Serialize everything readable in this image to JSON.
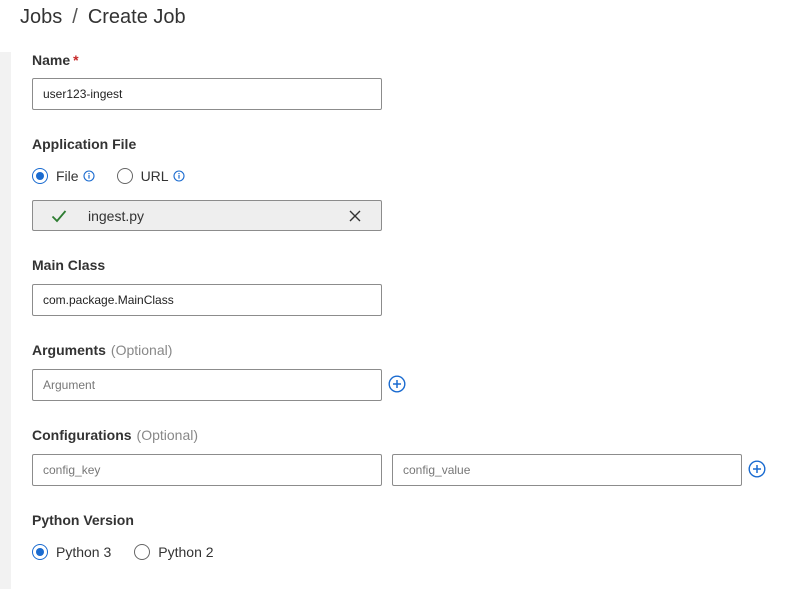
{
  "breadcrumb": {
    "parent": "Jobs",
    "separator": "/",
    "current": "Create Job"
  },
  "form": {
    "name": {
      "label": "Name",
      "required_mark": "*",
      "value": "user123-ingest"
    },
    "application_file": {
      "label": "Application File",
      "options": [
        {
          "label": "File",
          "selected": true
        },
        {
          "label": "URL",
          "selected": false
        }
      ],
      "uploaded_file": "ingest.py"
    },
    "main_class": {
      "label": "Main Class",
      "value": "com.package.MainClass"
    },
    "arguments": {
      "label": "Arguments",
      "optional": "(Optional)",
      "placeholder": "Argument"
    },
    "configurations": {
      "label": "Configurations",
      "optional": "(Optional)",
      "key_placeholder": "config_key",
      "value_placeholder": "config_value"
    },
    "python_version": {
      "label": "Python Version",
      "options": [
        {
          "label": "Python 3",
          "selected": true
        },
        {
          "label": "Python 2",
          "selected": false
        }
      ]
    }
  },
  "colors": {
    "accent": "#1a6bd0",
    "success": "#2e7d32",
    "required": "#c62828"
  },
  "icons": [
    "info-icon",
    "check-icon",
    "close-icon",
    "add-circle-icon"
  ]
}
